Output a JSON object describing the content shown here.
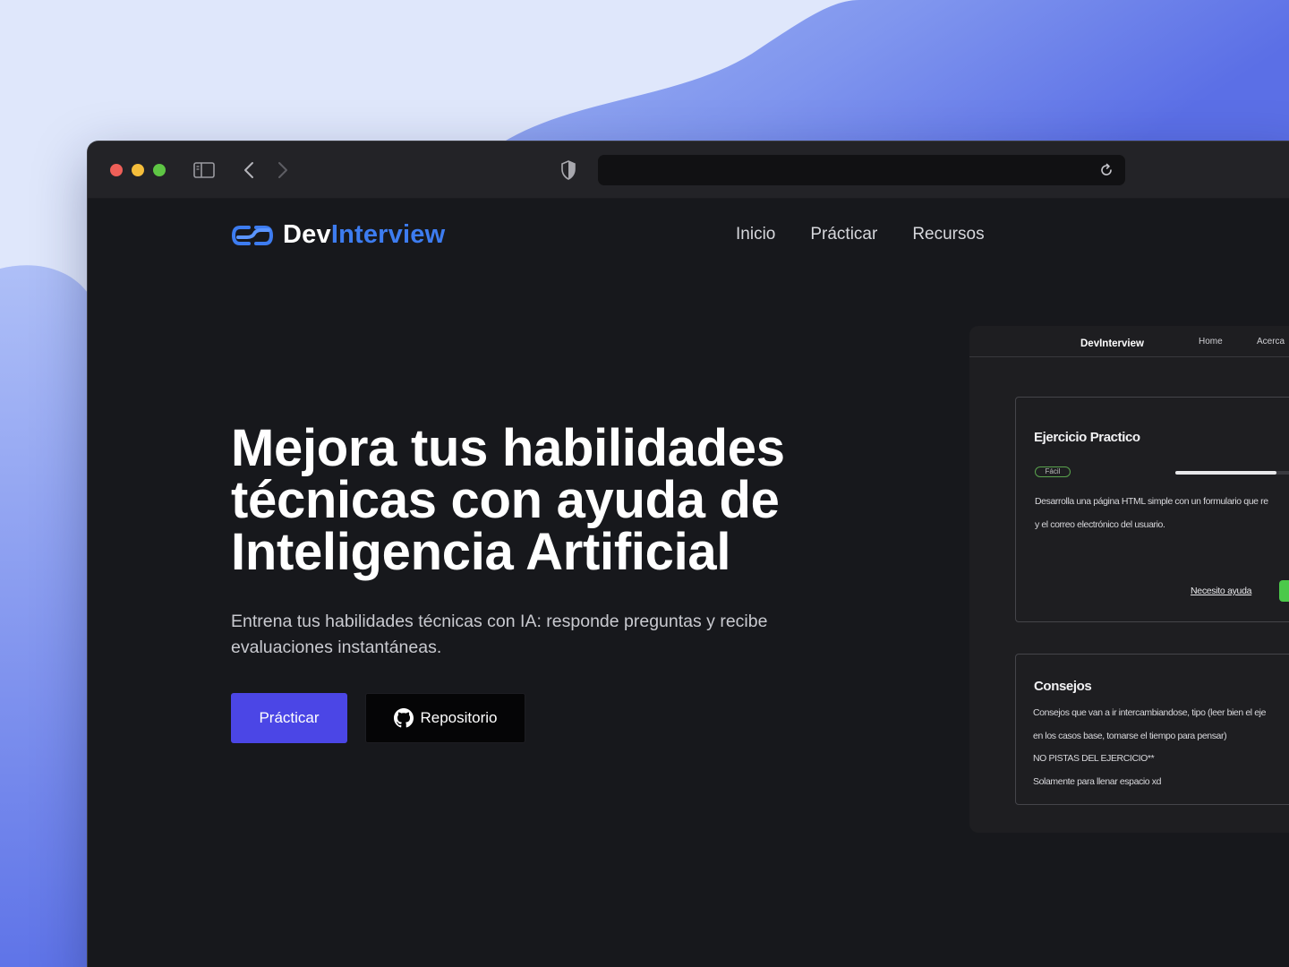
{
  "browser": {
    "url": ""
  },
  "site": {
    "logo": {
      "dev": "Dev",
      "interview": "Interview"
    },
    "nav": [
      "Inicio",
      "Prácticar",
      "Recursos"
    ]
  },
  "hero": {
    "title_lines": [
      "Mejora tus habilidades",
      "técnicas con ayuda de",
      "Inteligencia Artificial"
    ],
    "subtitle": "Entrena tus habilidades técnicas con IA: responde preguntas y recibe evaluaciones instantáneas.",
    "primary_button": "Prácticar",
    "repo_button": "Repositorio"
  },
  "preview": {
    "brand": "DevInterview",
    "nav": [
      "Home",
      "Acerca"
    ],
    "exercise": {
      "title": "Ejercicio Practico",
      "difficulty": "Fácil",
      "progress": 0.7,
      "description_lines": [
        "Desarrolla una página HTML simple con un formulario que re",
        "y el correo electrónico del usuario."
      ],
      "help_link": "Necesito ayuda"
    },
    "tips": {
      "title": "Consejos",
      "lines": [
        "Consejos que van a ir intercambiandose, tipo (leer bien el eje",
        "en los casos base,  tomarse el tiempo para pensar)",
        "NO PISTAS DEL EJERCICIO**",
        "Solamente para llenar espacio xd"
      ]
    }
  },
  "colors": {
    "accent": "#4b46e6",
    "logo_blue": "#3d7cf0",
    "window_bg": "#17181c",
    "success": "#4cc94a"
  },
  "icons": [
    "sidebar-icon",
    "back-icon",
    "forward-icon",
    "shield-icon",
    "reload-icon",
    "github-icon",
    "logo-mark-icon"
  ]
}
